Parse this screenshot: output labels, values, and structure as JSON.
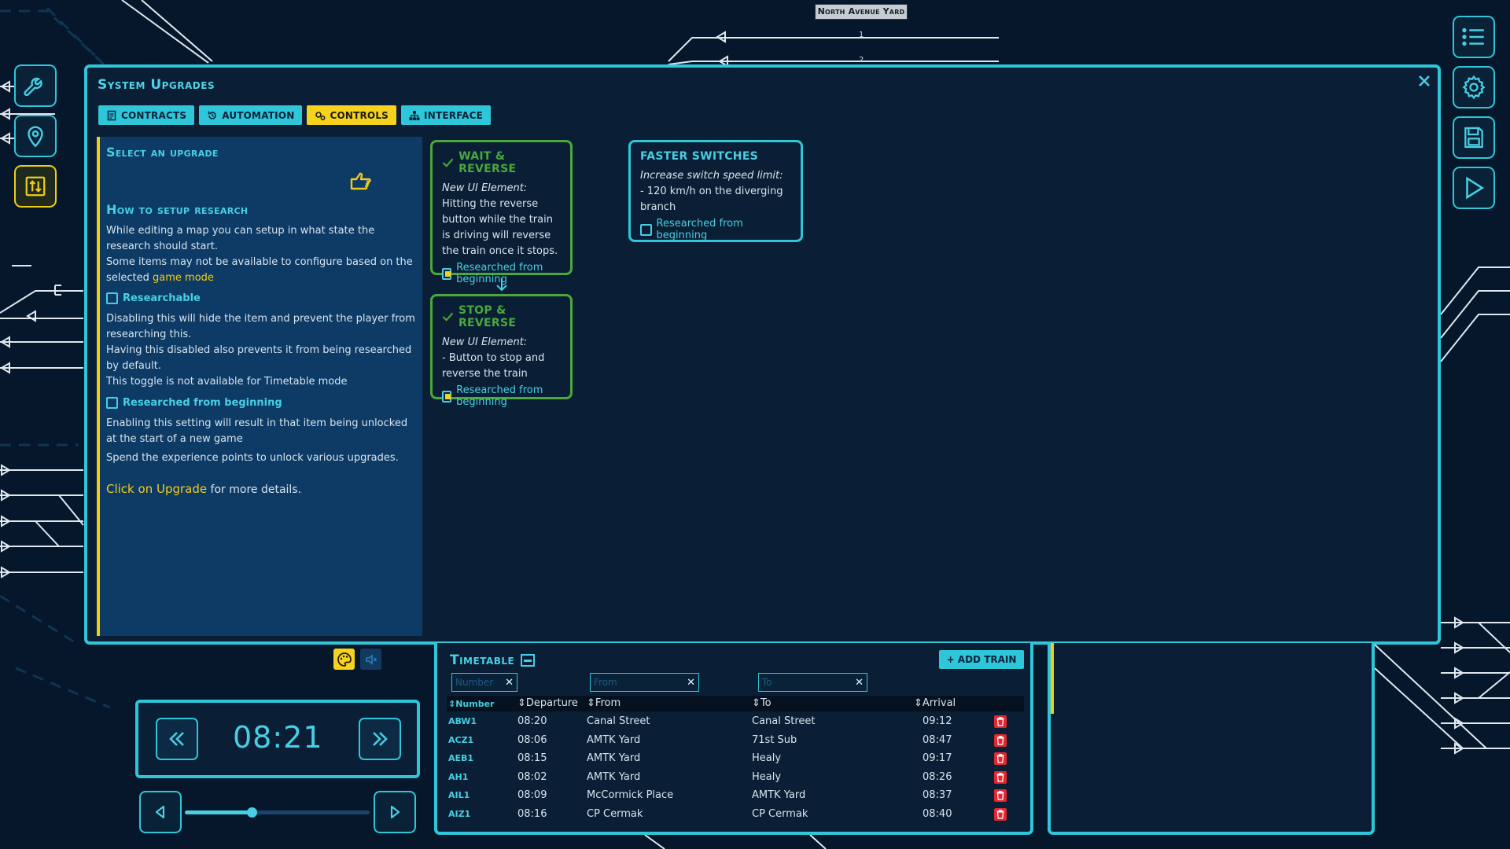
{
  "station": {
    "name": "North Avenue Yard",
    "track_1": "1",
    "track_2": "2"
  },
  "left_tools": [
    {
      "name": "wrench-icon"
    },
    {
      "name": "map-pin-icon"
    },
    {
      "name": "swap-icon"
    }
  ],
  "right_tools": [
    {
      "name": "list-icon"
    },
    {
      "name": "gear-icon"
    },
    {
      "name": "save-icon"
    },
    {
      "name": "play-icon"
    }
  ],
  "panel": {
    "title": "System Upgrades",
    "tabs": [
      {
        "label": "CONTRACTS",
        "icon": "document-icon",
        "active": false
      },
      {
        "label": "AUTOMATION",
        "icon": "refresh-icon",
        "active": false
      },
      {
        "label": "CONTROLS",
        "icon": "gears-icon",
        "active": true
      },
      {
        "label": "INTERFACE",
        "icon": "hierarchy-icon",
        "active": false
      }
    ]
  },
  "info": {
    "heading": "Select an upgrade",
    "setup_heading": "How to setup research",
    "setup_text_1": "While editing a map you can setup in what state the research should start.",
    "setup_text_2": "Some items may not be available to configure based on the selected ",
    "setup_text_2_link": "game mode",
    "researchable_label": "Researchable",
    "researchable_text_1": "Disabling this will hide the item and prevent the player from researching this.",
    "researchable_text_2": "Having this disabled also prevents it from being researched by default.",
    "researchable_text_3": "This toggle is not available for Timetable mode",
    "researched_label": "Researched from beginning",
    "researched_text": "Enabling this setting will result in that item being unlocked at the start of a new game",
    "xp_text": "Spend the experience points to unlock various upgrades.",
    "click_link": "Click on Upgrade",
    "click_rest": " for more details."
  },
  "cards": [
    {
      "title": "WAIT & REVERSE",
      "subtitle": "New UI Element:",
      "body": "Hitting the reverse button while the train is driving will reverse the train once it stops.",
      "check_label": "Researched from beginning",
      "checked": true
    },
    {
      "title": "STOP & REVERSE",
      "subtitle": "New UI Element:",
      "body": "- Button to stop and reverse the train",
      "check_label": "Researched from beginning",
      "checked": true
    },
    {
      "title": "FASTER SWITCHES",
      "subtitle": "Increase switch speed limit:",
      "body": "- 120 km/h on the diverging branch",
      "check_label": "Researched from beginning",
      "checked": false
    }
  ],
  "clock": {
    "time": "08:21",
    "speed_level": 0.36
  },
  "timetable": {
    "title": "Timetable",
    "add_label": "+ ADD TRAIN",
    "filters": {
      "number": "Number",
      "from": "From",
      "to": "To"
    },
    "columns": [
      "Number",
      "Departure",
      "From",
      "To",
      "Arrival"
    ],
    "rows": [
      {
        "number": "ABW1",
        "departure": "08:20",
        "from": "Canal Street",
        "to": "Canal Street",
        "arrival": "09:12"
      },
      {
        "number": "ACZ1",
        "departure": "08:06",
        "from": "AMTK Yard",
        "to": "71st Sub",
        "arrival": "08:47"
      },
      {
        "number": "AEB1",
        "departure": "08:15",
        "from": "AMTK Yard",
        "to": "Healy",
        "arrival": "09:17"
      },
      {
        "number": "AH1",
        "departure": "08:02",
        "from": "AMTK Yard",
        "to": "Healy",
        "arrival": "08:26"
      },
      {
        "number": "AIL1",
        "departure": "08:09",
        "from": "McCormick Place",
        "to": "AMTK Yard",
        "arrival": "08:37"
      },
      {
        "number": "AIZ1",
        "departure": "08:16",
        "from": "CP Cermak",
        "to": "CP Cermak",
        "arrival": "08:40"
      }
    ]
  },
  "colors": {
    "accent": "#2ec6d8",
    "highlight": "#f4d21e",
    "success": "#4ca83a",
    "danger": "#e3262f"
  }
}
